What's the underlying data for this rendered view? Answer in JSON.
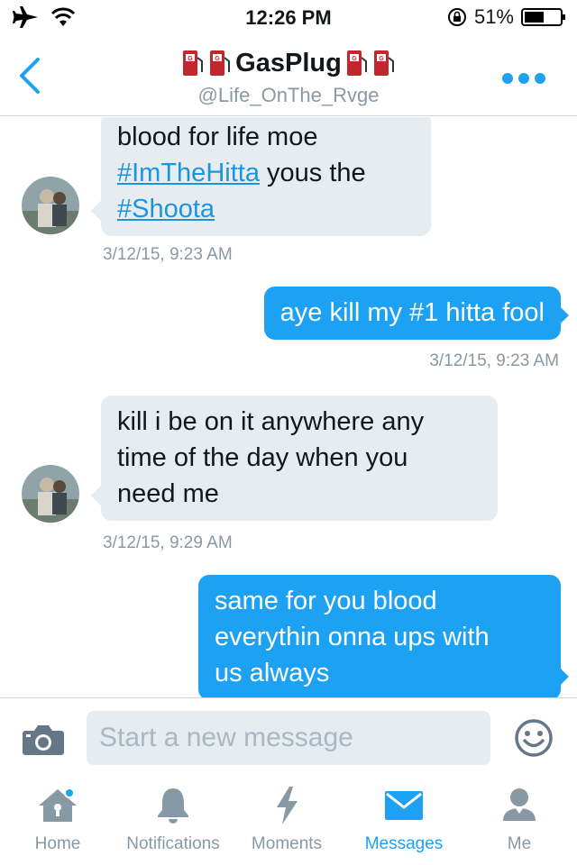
{
  "status_bar": {
    "time": "12:26 PM",
    "battery": "51%"
  },
  "header": {
    "title": "GasPlug",
    "handle": "@Life_OnThe_Rvge"
  },
  "messages": [
    {
      "direction": "incoming",
      "parts": [
        {
          "text": "blood for life moe"
        },
        {
          "hashtag": "#ImTheHitta",
          "text": " yous the"
        },
        {
          "hashtag": "#Shoota"
        }
      ],
      "timestamp": "3/12/15, 9:23 AM"
    },
    {
      "direction": "outgoing",
      "text": "aye kill my #1 hitta fool",
      "timestamp": "3/12/15, 9:23 AM"
    },
    {
      "direction": "incoming",
      "lines": [
        "kill i be on it anywhere any",
        "time of the day when you",
        "need me"
      ],
      "timestamp": "3/12/15, 9:29 AM"
    },
    {
      "direction": "outgoing",
      "lines": [
        "same for you blood",
        "everythin onna ups with",
        "us always"
      ]
    }
  ],
  "composer": {
    "placeholder": "Start a new message"
  },
  "tabs": [
    {
      "label": "Home",
      "icon": "home-icon",
      "has_notification_dot": true
    },
    {
      "label": "Notifications",
      "icon": "bell-icon"
    },
    {
      "label": "Moments",
      "icon": "lightning-icon"
    },
    {
      "label": "Messages",
      "icon": "envelope-icon",
      "active": true
    },
    {
      "label": "Me",
      "icon": "person-icon"
    }
  ],
  "colors": {
    "accent": "#1da1f2",
    "incoming_bubble": "#e6ecf0",
    "muted_text": "#8899a6",
    "hashtag": "#1b95e0"
  }
}
